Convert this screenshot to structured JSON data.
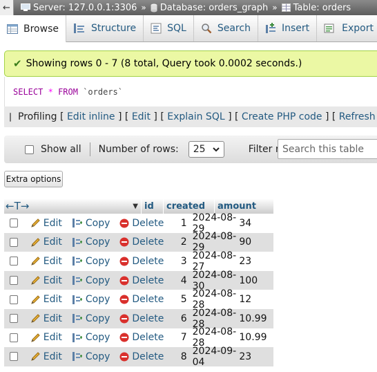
{
  "breadcrumb": {
    "server": "Server: 127.0.0.1:3306",
    "database": "Database: orders_graph",
    "table": "Table: orders"
  },
  "tabs": [
    {
      "label": "Browse",
      "icon": "browse-icon"
    },
    {
      "label": "Structure",
      "icon": "structure-icon"
    },
    {
      "label": "SQL",
      "icon": "sql-icon"
    },
    {
      "label": "Search",
      "icon": "search-icon"
    },
    {
      "label": "Insert",
      "icon": "insert-icon"
    },
    {
      "label": "Export",
      "icon": "export-icon"
    }
  ],
  "message": "Showing rows 0 - 7 (8 total, Query took 0.0002 seconds.)",
  "query": {
    "select": "SELECT",
    "star": "*",
    "from": "FROM",
    "table": "`orders`"
  },
  "profiling": {
    "label": "Profiling",
    "links": [
      "Edit inline",
      "Edit",
      "Explain SQL",
      "Create PHP code",
      "Refresh"
    ]
  },
  "nav": {
    "show_all": "Show all",
    "rows_label": "Number of rows:",
    "rows_value": "25",
    "filter_label": "Filter rows:",
    "filter_placeholder": "Search this table"
  },
  "extra_options": "Extra options",
  "columns": {
    "id": "id",
    "created": "created",
    "amount": "amount"
  },
  "actions": {
    "edit": "Edit",
    "copy": "Copy",
    "delete": "Delete"
  },
  "rows": [
    {
      "id": "1",
      "created": "2024-08-29",
      "amount": "34"
    },
    {
      "id": "2",
      "created": "2024-08-29",
      "amount": "90"
    },
    {
      "id": "3",
      "created": "2024-08-27",
      "amount": "23"
    },
    {
      "id": "4",
      "created": "2024-08-30",
      "amount": "100"
    },
    {
      "id": "5",
      "created": "2024-08-28",
      "amount": "12"
    },
    {
      "id": "6",
      "created": "2024-08-28",
      "amount": "10.99"
    },
    {
      "id": "7",
      "created": "2024-08-28",
      "amount": "10.99"
    },
    {
      "id": "8",
      "created": "2024-09-04",
      "amount": "23"
    }
  ],
  "colors": {
    "link": "#235a81",
    "success_bg": "#ebf8a4",
    "row_alt": "#dfdfdf"
  }
}
